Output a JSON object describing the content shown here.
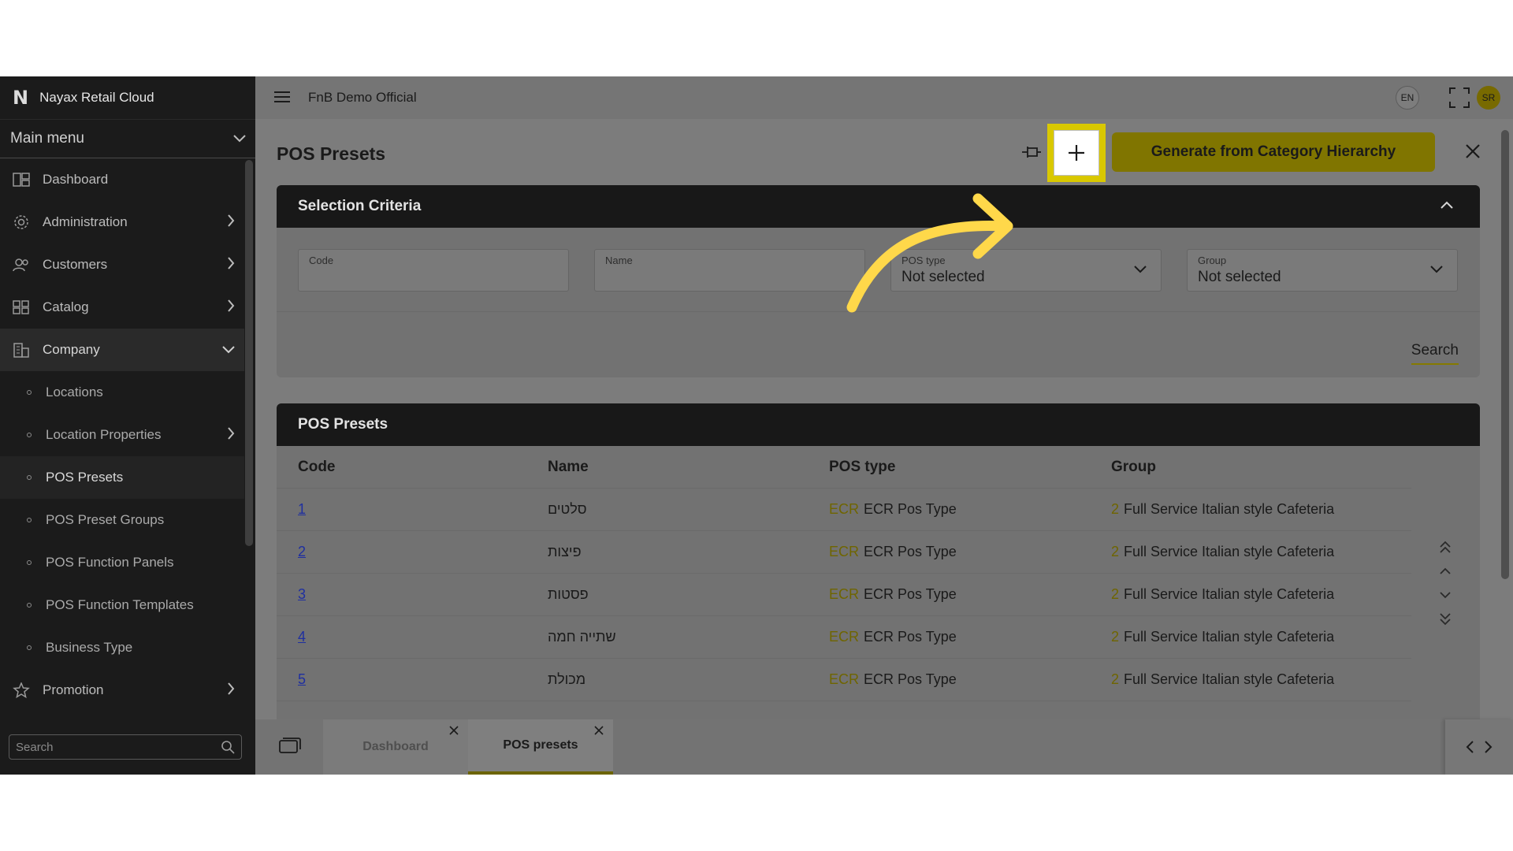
{
  "app": {
    "brand": "Nayax Retail Cloud",
    "main_menu_label": "Main menu",
    "breadcrumb": "FnB Demo Official",
    "lang": "EN",
    "avatar_initials": "SR"
  },
  "sidebar": {
    "items": [
      {
        "label": "Dashboard"
      },
      {
        "label": "Administration"
      },
      {
        "label": "Customers"
      },
      {
        "label": "Catalog"
      },
      {
        "label": "Company"
      },
      {
        "label": "Locations"
      },
      {
        "label": "Location Properties"
      },
      {
        "label": "POS Presets"
      },
      {
        "label": "POS Preset Groups"
      },
      {
        "label": "POS Function Panels"
      },
      {
        "label": "POS Function Templates"
      },
      {
        "label": "Business Type"
      },
      {
        "label": "Promotion"
      }
    ],
    "search_placeholder": "Search"
  },
  "page": {
    "title": "POS Presets",
    "generate_button": "Generate from Category Hierarchy"
  },
  "criteria": {
    "title": "Selection Criteria",
    "code_label": "Code",
    "name_label": "Name",
    "pos_type_label": "POS type",
    "pos_type_value": "Not selected",
    "group_label": "Group",
    "group_value": "Not selected",
    "search_button": "Search"
  },
  "table": {
    "title": "POS Presets",
    "columns": [
      "Code",
      "Name",
      "POS type",
      "Group"
    ],
    "rows": [
      {
        "code": "1",
        "name": "סלטים",
        "pos_code": "ECR",
        "pos_type": "ECR Pos Type",
        "group_code": "2",
        "group": "Full Service Italian style Cafeteria"
      },
      {
        "code": "2",
        "name": "פיצות",
        "pos_code": "ECR",
        "pos_type": "ECR Pos Type",
        "group_code": "2",
        "group": "Full Service Italian style Cafeteria"
      },
      {
        "code": "3",
        "name": "פסטות",
        "pos_code": "ECR",
        "pos_type": "ECR Pos Type",
        "group_code": "2",
        "group": "Full Service Italian style Cafeteria"
      },
      {
        "code": "4",
        "name": "שתייה חמה",
        "pos_code": "ECR",
        "pos_type": "ECR Pos Type",
        "group_code": "2",
        "group": "Full Service Italian style Cafeteria"
      },
      {
        "code": "5",
        "name": "מכולת",
        "pos_code": "ECR",
        "pos_type": "ECR Pos Type",
        "group_code": "2",
        "group": "Full Service Italian style Cafeteria"
      }
    ]
  },
  "footer": {
    "tabs": [
      {
        "label": "Dashboard"
      },
      {
        "label": "POS presets"
      }
    ]
  },
  "colors": {
    "accent": "#d9c800",
    "sidebar_bg": "#1b1b1b",
    "overlay_bg": "#7c7c7c",
    "arrow": "#ffd84a"
  }
}
